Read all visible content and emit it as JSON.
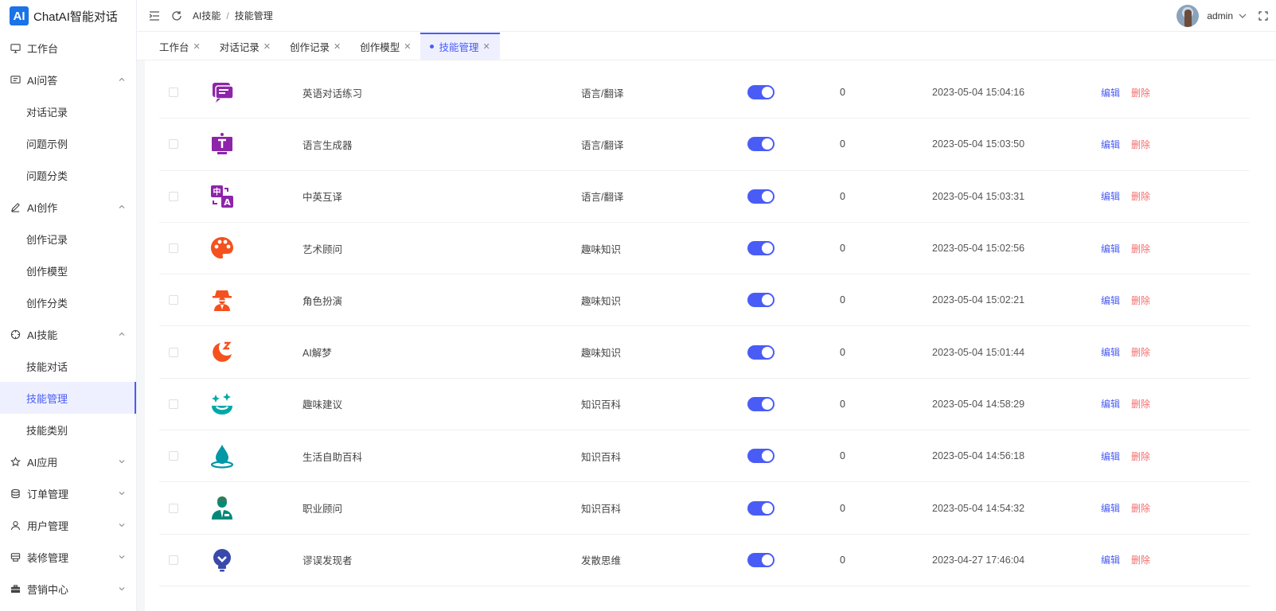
{
  "brand": {
    "logo": "AI",
    "title": "ChatAI智能对话"
  },
  "sidebar": {
    "items": [
      {
        "label": "工作台",
        "icon": "monitor-icon",
        "level": 1,
        "chevron": ""
      },
      {
        "label": "AI问答",
        "icon": "chat-icon",
        "level": 1,
        "chevron": "up"
      },
      {
        "label": "对话记录",
        "level": 2
      },
      {
        "label": "问题示例",
        "level": 2
      },
      {
        "label": "问题分类",
        "level": 2
      },
      {
        "label": "AI创作",
        "icon": "pen-icon",
        "level": 1,
        "chevron": "up"
      },
      {
        "label": "创作记录",
        "level": 2
      },
      {
        "label": "创作模型",
        "level": 2
      },
      {
        "label": "创作分类",
        "level": 2
      },
      {
        "label": "AI技能",
        "icon": "target-icon",
        "level": 1,
        "chevron": "up"
      },
      {
        "label": "技能对话",
        "level": 2
      },
      {
        "label": "技能管理",
        "level": 2,
        "active": true
      },
      {
        "label": "技能类别",
        "level": 2
      },
      {
        "label": "AI应用",
        "icon": "star-icon",
        "level": 1,
        "chevron": "down"
      },
      {
        "label": "订单管理",
        "icon": "database-icon",
        "level": 1,
        "chevron": "down"
      },
      {
        "label": "用户管理",
        "icon": "user-icon",
        "level": 1,
        "chevron": "down"
      },
      {
        "label": "装修管理",
        "icon": "layout-icon",
        "level": 1,
        "chevron": "down"
      },
      {
        "label": "营销中心",
        "icon": "briefcase-icon",
        "level": 1,
        "chevron": "down"
      }
    ]
  },
  "header": {
    "breadcrumb": [
      "AI技能",
      "技能管理"
    ],
    "separator": "/",
    "user": "admin"
  },
  "tabs": [
    {
      "label": "工作台",
      "active": false
    },
    {
      "label": "对话记录",
      "active": false
    },
    {
      "label": "创作记录",
      "active": false
    },
    {
      "label": "创作模型",
      "active": false
    },
    {
      "label": "技能管理",
      "active": true
    }
  ],
  "table": {
    "edit_label": "编辑",
    "delete_label": "删除",
    "rows": [
      {
        "name": "英语对话练习",
        "category": "语言/翻译",
        "count": "0",
        "time": "2023-05-04 15:04:16",
        "icon": "speech-bubble-icon",
        "icon_color": "#8e24aa"
      },
      {
        "name": "语言生成器",
        "category": "语言/翻译",
        "count": "0",
        "time": "2023-05-04 15:03:50",
        "icon": "text-screen-icon",
        "icon_color": "#8e24aa"
      },
      {
        "name": "中英互译",
        "category": "语言/翻译",
        "count": "0",
        "time": "2023-05-04 15:03:31",
        "icon": "translate-icon",
        "icon_color": "#8e24aa"
      },
      {
        "name": "艺术顾问",
        "category": "趣味知识",
        "count": "0",
        "time": "2023-05-04 15:02:56",
        "icon": "palette-icon",
        "icon_color": "#f4511e"
      },
      {
        "name": "角色扮演",
        "category": "趣味知识",
        "count": "0",
        "time": "2023-05-04 15:02:21",
        "icon": "detective-icon",
        "icon_color": "#f4511e"
      },
      {
        "name": "AI解梦",
        "category": "趣味知识",
        "count": "0",
        "time": "2023-05-04 15:01:44",
        "icon": "moon-sleep-icon",
        "icon_color": "#f4511e"
      },
      {
        "name": "趣味建议",
        "category": "知识百科",
        "count": "0",
        "time": "2023-05-04 14:58:29",
        "icon": "sparkle-smile-icon",
        "icon_color": "#00a8a8"
      },
      {
        "name": "生活自助百科",
        "category": "知识百科",
        "count": "0",
        "time": "2023-05-04 14:56:18",
        "icon": "water-drop-icon",
        "icon_color": "#0097a7"
      },
      {
        "name": "职业顾问",
        "category": "知识百科",
        "count": "0",
        "time": "2023-05-04 14:54:32",
        "icon": "businessman-icon",
        "icon_color": "#00897b"
      },
      {
        "name": "谬误发现者",
        "category": "发散思维",
        "count": "0",
        "time": "2023-04-27 17:46:04",
        "icon": "lightbulb-icon",
        "icon_color": "#3949ab"
      }
    ]
  }
}
